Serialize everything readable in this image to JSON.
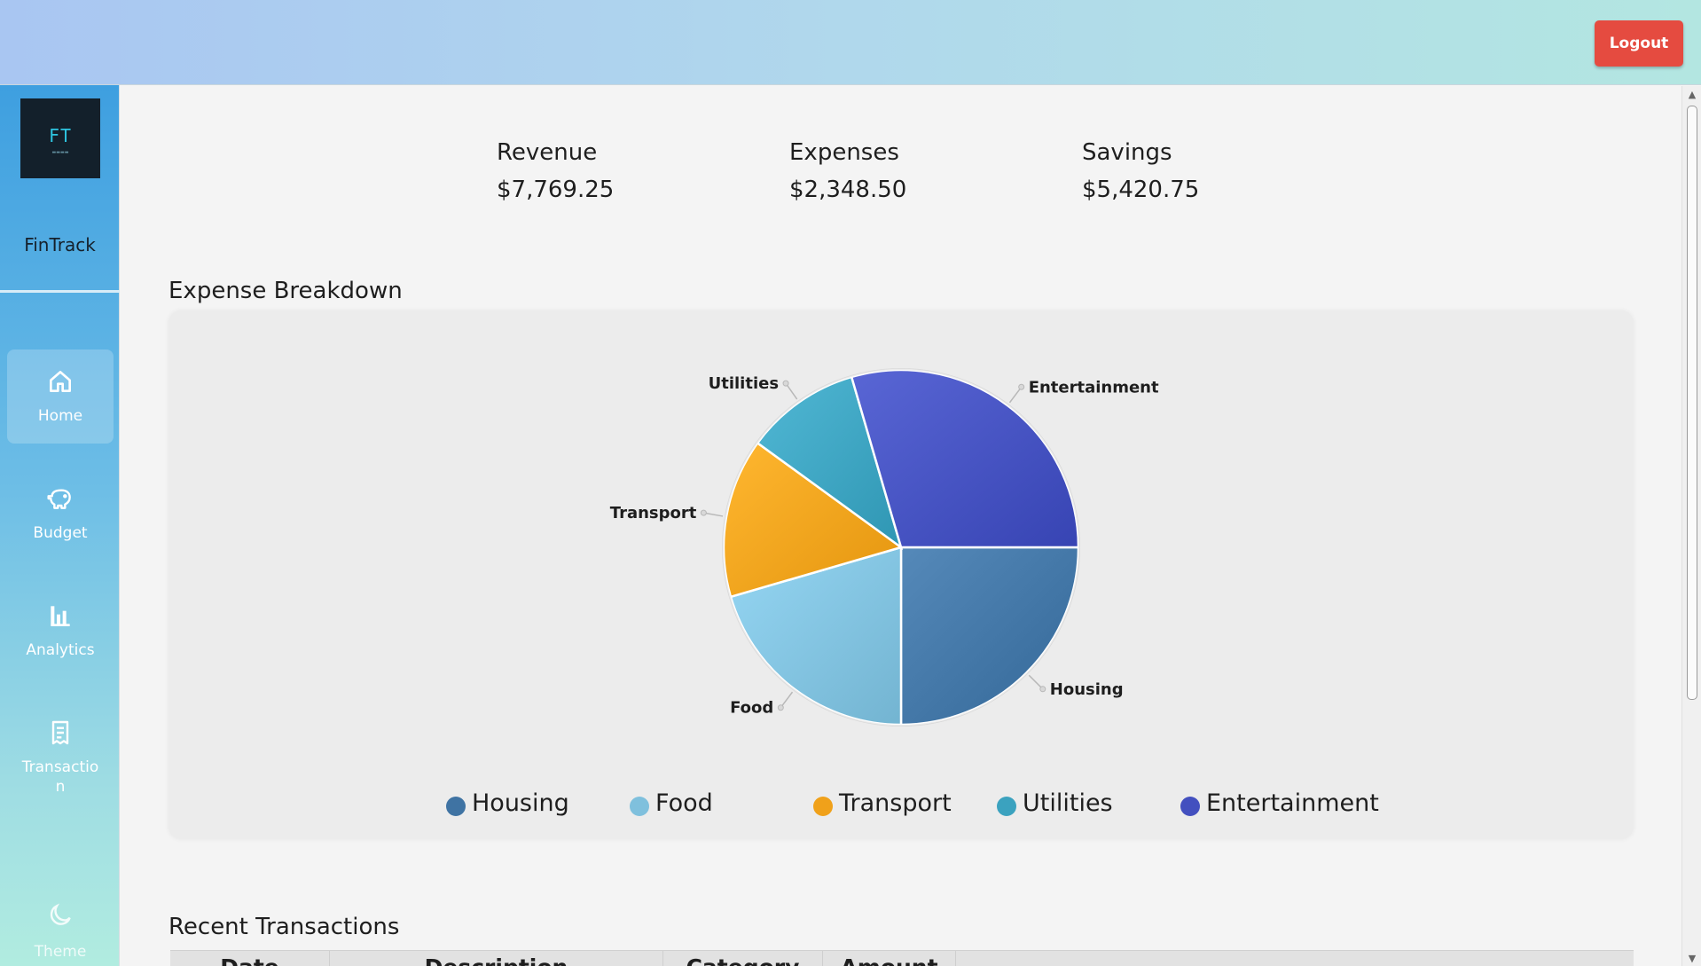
{
  "header": {
    "logout_label": "Logout"
  },
  "sidebar": {
    "logo_text": "FT",
    "brand": "FinTrack",
    "items": [
      {
        "label": "Home",
        "icon": "home-icon",
        "active": true
      },
      {
        "label": "Budget",
        "icon": "piggy-bank-icon"
      },
      {
        "label": "Analytics",
        "icon": "bar-chart-icon"
      },
      {
        "label": "Transactio\nn",
        "icon": "receipt-icon"
      }
    ],
    "theme_label": "Theme"
  },
  "summary": [
    {
      "label": "Revenue",
      "value": "$7,769.25"
    },
    {
      "label": "Expenses",
      "value": "$2,348.50"
    },
    {
      "label": "Savings",
      "value": "$5,420.75"
    }
  ],
  "expense_breakdown": {
    "title": "Expense Breakdown",
    "chart_data": {
      "type": "pie",
      "categories": [
        "Housing",
        "Food",
        "Transport",
        "Utilities",
        "Entertainment"
      ],
      "values": [
        25,
        20.5,
        14.5,
        10.5,
        29.5
      ],
      "colors": [
        "#3f73a3",
        "#7fc0dd",
        "#f0a11a",
        "#3ba2bf",
        "#4350bf"
      ],
      "legend": "bottom"
    }
  },
  "transactions": {
    "title": "Recent Transactions",
    "columns": [
      "Date",
      "Description",
      "Category",
      "Amount"
    ]
  }
}
